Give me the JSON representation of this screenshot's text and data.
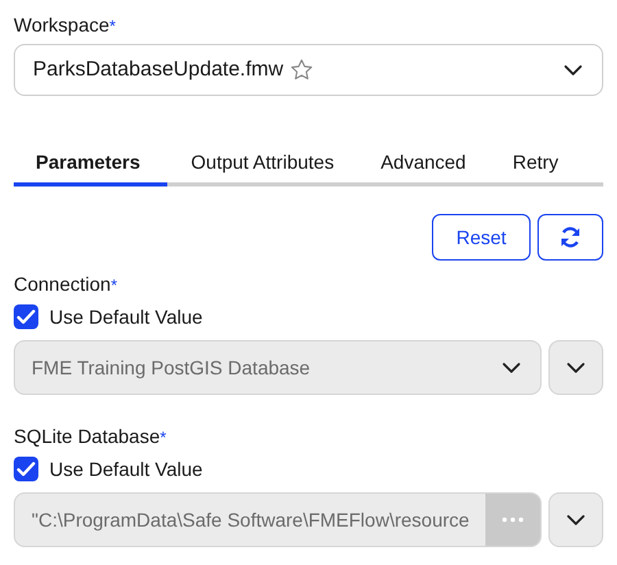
{
  "workspace": {
    "label": "Workspace",
    "required_mark": "*",
    "value": "ParksDatabaseUpdate.fmw"
  },
  "tabs": [
    {
      "label": "Parameters",
      "selected": true
    },
    {
      "label": "Output Attributes",
      "selected": false
    },
    {
      "label": "Advanced",
      "selected": false
    },
    {
      "label": "Retry",
      "selected": false
    }
  ],
  "actions": {
    "reset": "Reset"
  },
  "parameters": [
    {
      "kind": "select",
      "label": "Connection",
      "required_mark": "*",
      "use_default": {
        "label": "Use Default Value",
        "checked": true
      },
      "value": "FME Training PostGIS Database",
      "disabled": true
    },
    {
      "kind": "file",
      "label": "SQLite Database",
      "required_mark": "*",
      "use_default": {
        "label": "Use Default Value",
        "checked": true
      },
      "value": "\"C:\\ProgramData\\Safe Software\\FMEFlow\\resource",
      "disabled": true
    }
  ]
}
